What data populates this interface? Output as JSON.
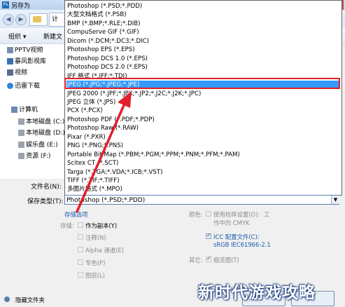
{
  "window": {
    "title": "另存为",
    "app_icon": "Ps"
  },
  "nav": {
    "back_icon": "back-arrow-icon",
    "forward_icon": "forward-arrow-icon",
    "address_tail": "计"
  },
  "toolbar": {
    "organize": "组织 ▾",
    "new_folder": "新建文"
  },
  "sidebar": {
    "items": [
      {
        "label": "PPTV视频",
        "icon": "video-folder-icon"
      },
      {
        "label": "暴风影视库",
        "icon": "library-icon"
      },
      {
        "label": "视频",
        "icon": "video-icon"
      },
      {
        "label": "迅雷下载",
        "icon": "download-icon"
      },
      {
        "label": "计算机",
        "icon": "computer-icon"
      },
      {
        "label": "本地磁盘 (C:)",
        "icon": "drive-icon"
      },
      {
        "label": "本地磁盘 (D:)",
        "icon": "drive-icon"
      },
      {
        "label": "娱乐盘 (E:)",
        "icon": "drive-icon"
      },
      {
        "label": "资源 (F:)",
        "icon": "drive-icon"
      }
    ]
  },
  "format_list": [
    "Photoshop (*.PSD;*.PDD)",
    "大型文档格式 (*.PSB)",
    "BMP (*.BMP;*.RLE;*.DIB)",
    "CompuServe GIF (*.GIF)",
    "Dicom (*.DCM;*.DC3;*.DIC)",
    "Photoshop EPS (*.EPS)",
    "Photoshop DCS 1.0 (*.EPS)",
    "Photoshop DCS 2.0 (*.EPS)",
    "IFF 格式 (*.IFF;*.TDI)",
    "JPEG (*.JPG;*.JPEG;*.JPE)",
    "JPEG 2000 (*.JPF;*.JPX;*.JP2;*.J2C;*.J2K;*.JPC)",
    "JPEG 立体 (*.JPS)",
    "PCX (*.PCX)",
    "Photoshop PDF (*.PDF;*.PDP)",
    "Photoshop Raw (*.RAW)",
    "Pixar (*.PXR)",
    "PNG (*.PNG;*.PNS)",
    "Portable Bit Map (*.PBM;*.PGM;*.PPM;*.PNM;*.PFM;*.PAM)",
    "Scitex CT (*.SCT)",
    "Targa (*.TGA;*.VDA;*.ICB;*.VST)",
    "TIFF (*.TIF;*.TIFF)",
    "多图片格式 (*.MPO)"
  ],
  "selected_index": 9,
  "file_name_label": "文件名(N):",
  "file_type_label": "保存类型(T):",
  "file_type_value": "Photoshop (*.PSD;*.PDD)",
  "save_options": {
    "heading": "存储选项",
    "storage_label": "存储:",
    "as_copy": "作为副本(Y)",
    "annotations": "注释(N)",
    "alpha": "Alpha 通道(E)",
    "spot": "专色(P)",
    "layers": "图层(L)"
  },
  "color": {
    "label": "颜色:",
    "proof": "使用校样设置(O):",
    "proof_tail": "工",
    "cmyk": "作中的 CMYK",
    "icc": "ICC 配置文件(C):",
    "icc_value": "sRGB IEC61966-2.1"
  },
  "other": {
    "label": "其它:",
    "thumbnail": "缩览图(T)"
  },
  "hide_folders": "隐藏文件夹",
  "watermark": "新时代游戏攻略",
  "colors": {
    "selection": "#3399ff",
    "highlight_box": "#e0202a",
    "arrow": "#e0202a",
    "link": "#1a5cb0"
  }
}
